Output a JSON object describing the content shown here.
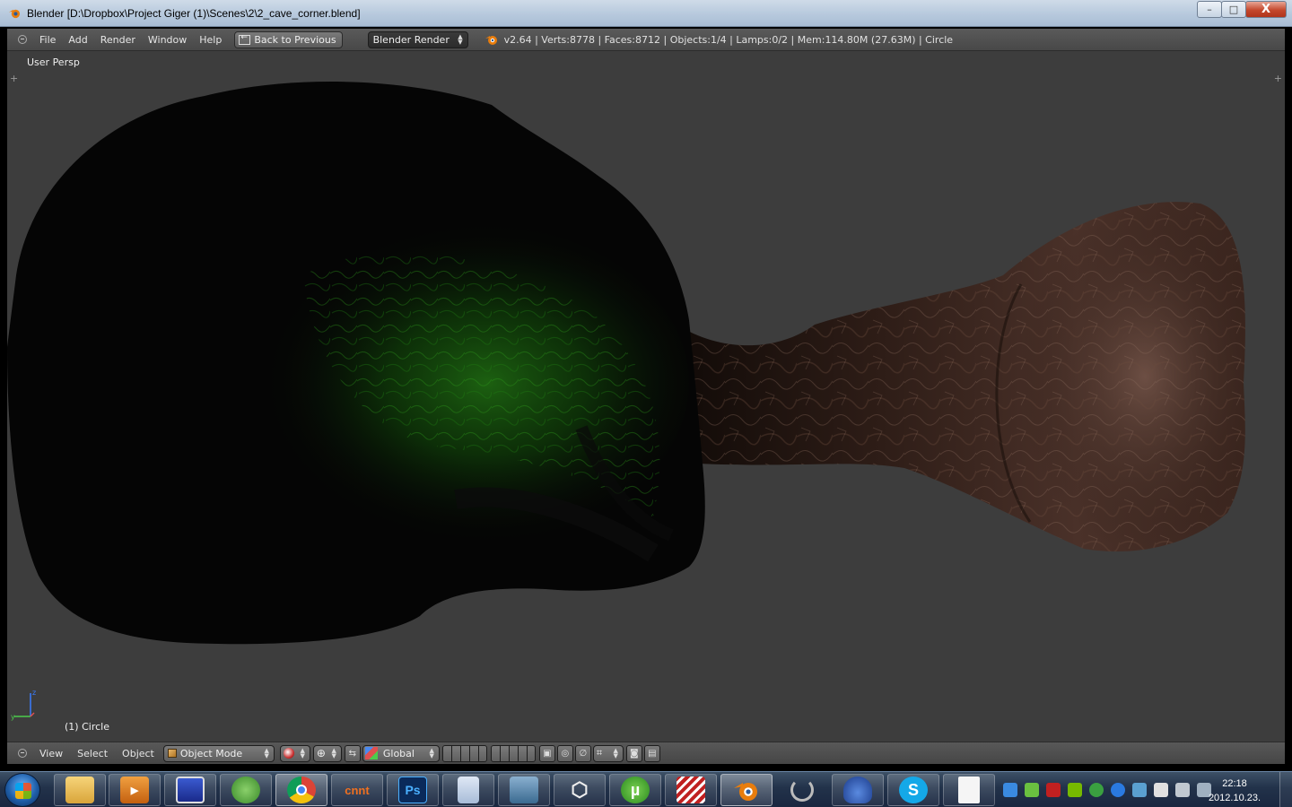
{
  "window": {
    "title": "Blender [D:\\Dropbox\\Project Giger (1)\\Scenes\\2\\2_cave_corner.blend]",
    "minimize": "–",
    "maximize": "□",
    "close": "X"
  },
  "info_header": {
    "menus": [
      "File",
      "Add",
      "Render",
      "Window",
      "Help"
    ],
    "back_button": "Back to Previous",
    "render_engine": "Blender Render",
    "stats": "v2.64 | Verts:8778 | Faces:8712 | Objects:1/4 | Lamps:0/2 | Mem:114.80M (27.63M) | Circle"
  },
  "viewport": {
    "view_label": "User Persp",
    "object_label": "(1) Circle",
    "background_color": "#3d3d3d"
  },
  "view_header": {
    "menus": [
      "View",
      "Select",
      "Object"
    ],
    "mode": "Object Mode",
    "orientation": "Global"
  },
  "taskbar": {
    "apps": [
      {
        "name": "explorer-icon",
        "label": ""
      },
      {
        "name": "media-player-icon",
        "label": ""
      },
      {
        "name": "save-icon",
        "label": ""
      },
      {
        "name": "messenger-icon",
        "label": ""
      },
      {
        "name": "chrome-icon",
        "label": ""
      },
      {
        "name": "cinema-app-icon",
        "label": "cnnt"
      },
      {
        "name": "photoshop-icon",
        "label": "Ps"
      },
      {
        "name": "calculator-icon",
        "label": ""
      },
      {
        "name": "task-manager-icon",
        "label": ""
      },
      {
        "name": "unity-icon",
        "label": ""
      },
      {
        "name": "utorrent-icon",
        "label": "µ"
      },
      {
        "name": "striped-app-icon",
        "label": ""
      },
      {
        "name": "blender-icon",
        "label": ""
      },
      {
        "name": "loading-app-icon",
        "label": ""
      },
      {
        "name": "car-app-icon",
        "label": ""
      },
      {
        "name": "skype-icon",
        "label": "S"
      },
      {
        "name": "document-icon",
        "label": ""
      }
    ],
    "clock_time": "22:18",
    "clock_date": "2012.10.23."
  }
}
